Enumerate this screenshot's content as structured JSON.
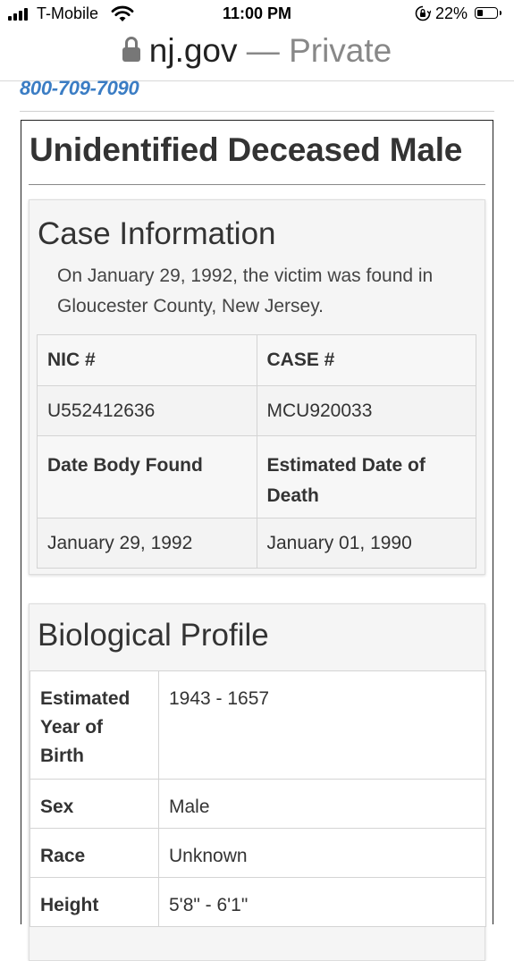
{
  "status_bar": {
    "carrier": "T-Mobile",
    "time": "11:00 PM",
    "battery": "22%",
    "icons": [
      "signal-icon",
      "wifi-icon",
      "orientation-lock-icon",
      "battery-icon"
    ]
  },
  "browser": {
    "host": "nj.gov",
    "separator": "—",
    "mode": "Private",
    "icon": "lock-icon"
  },
  "page": {
    "phone": "800-709-7090",
    "title": "Unidentified Deceased Male",
    "case_info": {
      "heading": "Case Information",
      "description": "On January 29, 1992, the victim was found in Gloucester County, New Jersey.",
      "nic_label": "NIC #",
      "case_label": "CASE #",
      "nic_value": "U552412636",
      "case_value": "MCU920033",
      "date_found_label": "Date Body Found",
      "est_death_label": "Estimated Date of Death",
      "date_found_value": "January 29, 1992",
      "est_death_value": "January 01, 1990"
    },
    "bio_profile": {
      "heading": "Biological Profile",
      "rows": [
        {
          "label": "Estimated Year of Birth",
          "value": "1943 - 1657"
        },
        {
          "label": "Sex",
          "value": "Male"
        },
        {
          "label": "Race",
          "value": "Unknown"
        },
        {
          "label": "Height",
          "value": "5'8\" - 6'1\""
        }
      ]
    }
  }
}
